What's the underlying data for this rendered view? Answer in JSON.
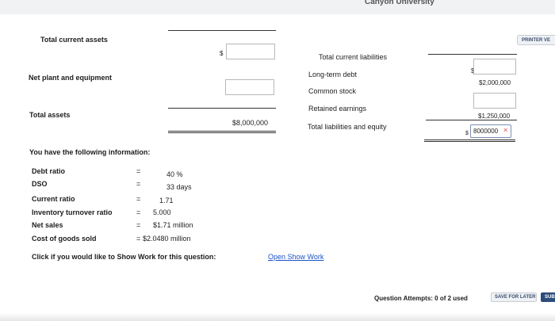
{
  "header": {
    "university": "Canyon University",
    "printer_label": "PRINTER VE"
  },
  "left": {
    "total_current_assets": "Total current assets",
    "dollar_sign": "$",
    "net_plant": "Net plant and equipment",
    "total_assets": "Total assets",
    "total_assets_value": "$8,000,000"
  },
  "right": {
    "total_current_liabilities": "Total current liabilities",
    "long_term_debt": "Long-term debt",
    "common_stock": "Common stock",
    "retained_earnings": "Retained earnings",
    "total_liab_equity": "Total liabilities and equity",
    "dollar_sign": "$",
    "long_term_debt_value": "$2,000,000",
    "retained_earnings_value": "$1,250,000",
    "total_input_value": "8000000",
    "error_mark": "×"
  },
  "info": {
    "intro": "You have the following information:",
    "rows": [
      {
        "label": "Debt ratio",
        "eq": "=",
        "value": "40 %"
      },
      {
        "label": "DSO",
        "eq": "=",
        "value": "33 days"
      },
      {
        "label": "Current ratio",
        "eq": "=",
        "value": "1.71"
      },
      {
        "label": "Inventory turnover ratio",
        "eq": "=",
        "value": "5.000"
      },
      {
        "label": "Net sales",
        "eq": "=",
        "value": "$1.71 million"
      },
      {
        "label": "Cost of goods sold",
        "eq": "=",
        "value": "$2.0480 million"
      }
    ]
  },
  "show_work": {
    "prompt": "Click if you would like to Show Work for this question:",
    "link": "Open Show Work"
  },
  "footer": {
    "attempts": "Question Attempts: 0 of 2 used",
    "save_later": "SAVE FOR LATER",
    "submit": "SUB"
  }
}
